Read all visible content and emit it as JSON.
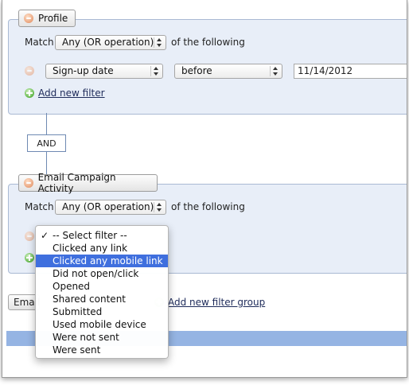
{
  "profile_group": {
    "title": "Profile",
    "match_label": "Match",
    "match_value": "Any (OR operation)",
    "match_suffix": "of the following",
    "filter": {
      "field": "Sign-up date",
      "operator": "before",
      "value": "11/14/2012"
    },
    "add_filter": "Add new filter"
  },
  "and_label": "AND",
  "email_group": {
    "title": "Email Campaign Activity",
    "match_label": "Match",
    "match_value": "Any (OR operation)",
    "match_suffix": "of the following"
  },
  "dropdown": {
    "selected": "-- Select filter --",
    "highlighted": "Clicked any mobile link",
    "options": [
      "-- Select filter --",
      "Clicked any link",
      "Clicked any mobile link",
      "Did not open/click",
      "Opened",
      "Shared content",
      "Submitted",
      "Used mobile device",
      "Were not sent",
      "Were sent"
    ]
  },
  "bottom": {
    "partial_button": "Email",
    "add_group": "Add new filter group"
  },
  "colors": {
    "highlight": "#3f6fde",
    "group_bg": "#e8eef8",
    "bar": "#95b4e3"
  }
}
